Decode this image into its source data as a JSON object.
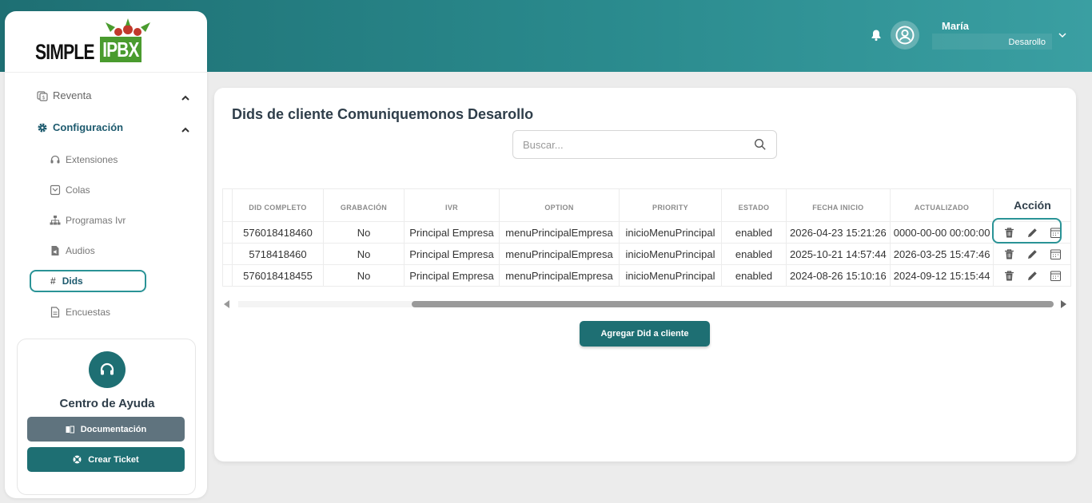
{
  "header": {
    "user_name": "María",
    "user_role": "Desarollo"
  },
  "logo": {
    "part1": "SIMPLE",
    "part2": "IPBX"
  },
  "sidebar": {
    "items": [
      {
        "label": "Reventa",
        "icon": "reventa-icon"
      },
      {
        "label": "Configuración",
        "icon": "gear-icon"
      }
    ],
    "subitems": [
      {
        "label": "Extensiones",
        "icon": "headset-icon"
      },
      {
        "label": "Colas",
        "icon": "queue-icon"
      },
      {
        "label": "Programas Ivr",
        "icon": "sitemap-icon"
      },
      {
        "label": "Audios",
        "icon": "audio-file-icon"
      },
      {
        "label": "Dids",
        "icon": "hash-icon"
      },
      {
        "label": "Encuestas",
        "icon": "survey-icon"
      }
    ],
    "help": {
      "title": "Centro de Ayuda",
      "doc_button": "Documentación",
      "ticket_button": "Crear Ticket"
    }
  },
  "main": {
    "title": "Dids de cliente Comuniquemonos Desarollo",
    "search_placeholder": "Buscar...",
    "columns": [
      "DID COMPLETO",
      "GRABACIÓN",
      "IVR",
      "OPTION",
      "PRIORITY",
      "ESTADO",
      "FECHA INICIO",
      "ACTUALIZADO"
    ],
    "action_header": "Acción",
    "rows": [
      [
        "576018418460",
        "No",
        "Principal Empresa",
        "menuPrincipalEmpresa",
        "inicioMenuPrincipal",
        "enabled",
        "2026-04-23 15:21:26",
        "0000-00-00 00:00:00"
      ],
      [
        "5718418460",
        "No",
        "Principal Empresa",
        "menuPrincipalEmpresa",
        "inicioMenuPrincipal",
        "enabled",
        "2025-10-21 14:57:44",
        "2026-03-25 15:47:46"
      ],
      [
        "576018418455",
        "No",
        "Principal Empresa",
        "menuPrincipalEmpresa",
        "inicioMenuPrincipal",
        "enabled",
        "2024-08-26 15:10:16",
        "2024-09-12 15:15:44"
      ]
    ],
    "add_button": "Agregar Did a cliente"
  },
  "colors": {
    "primary": "#1e6f73",
    "accent": "#2a9396",
    "doc_button": "#5f737e"
  }
}
